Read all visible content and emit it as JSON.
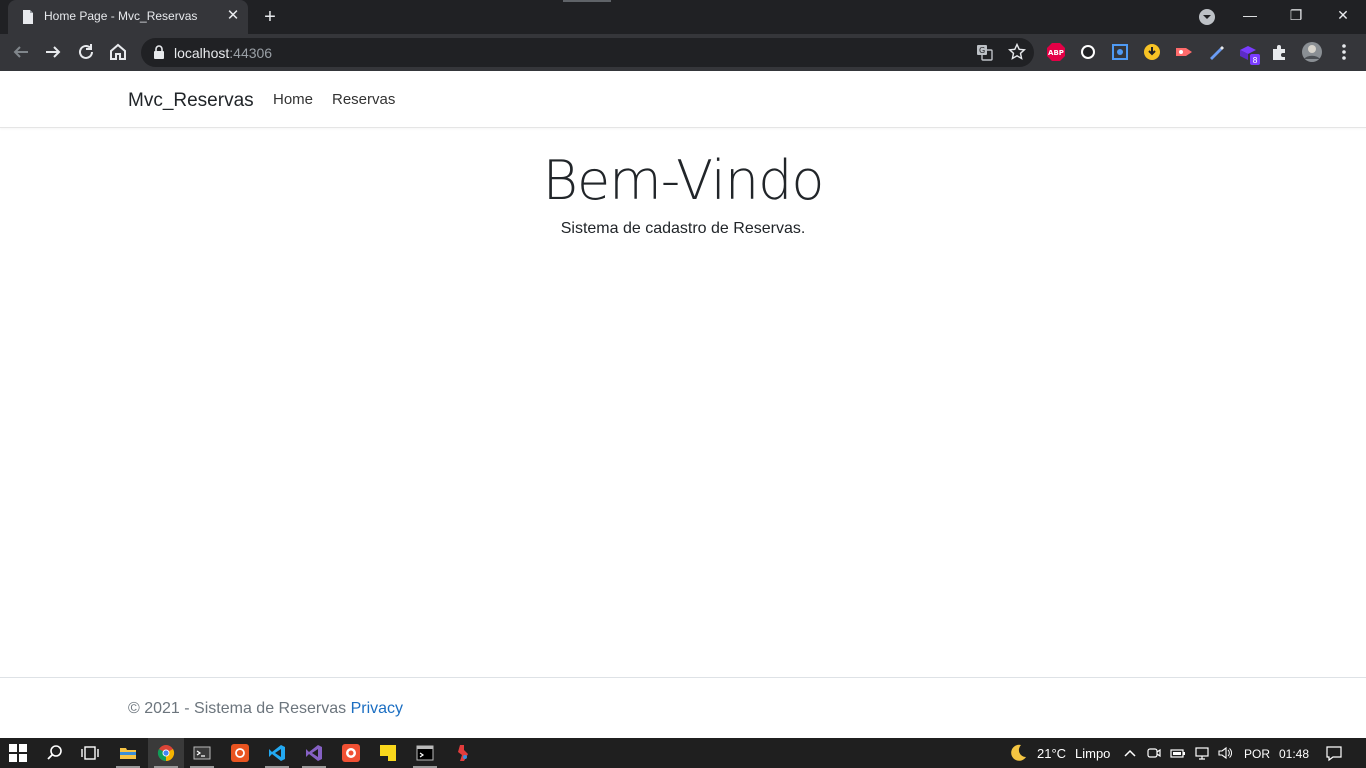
{
  "browser": {
    "tab_title": "Home Page - Mvc_Reservas",
    "url_host": "localhost",
    "url_port": ":44306",
    "extensions": [
      {
        "name": "abp-icon",
        "label": "ABP",
        "color": "#e40046"
      },
      {
        "name": "whatsapp-icon",
        "color": "#ffffff"
      },
      {
        "name": "screenshot-icon",
        "color": "#4f9bf5"
      },
      {
        "name": "download-icon",
        "color": "#f7c325"
      },
      {
        "name": "record-icon",
        "color": "#ff6b6b"
      },
      {
        "name": "pen-icon",
        "color": "#6a9cf5"
      },
      {
        "name": "extension-badge-icon",
        "badge": "8",
        "color": "#7a3cff"
      }
    ]
  },
  "site": {
    "brand": "Mvc_Reservas",
    "nav": [
      "Home",
      "Reservas"
    ],
    "heading": "Bem-Vindo",
    "subheading": "Sistema de cadastro de Reservas.",
    "footer_text": "© 2021 - Sistema de Reservas ",
    "footer_link": "Privacy",
    "link_color": "#1b6ec2"
  },
  "taskbar": {
    "weather_temp": "21°C",
    "weather_desc": "Limpo",
    "language": "POR",
    "time": "01:48"
  }
}
